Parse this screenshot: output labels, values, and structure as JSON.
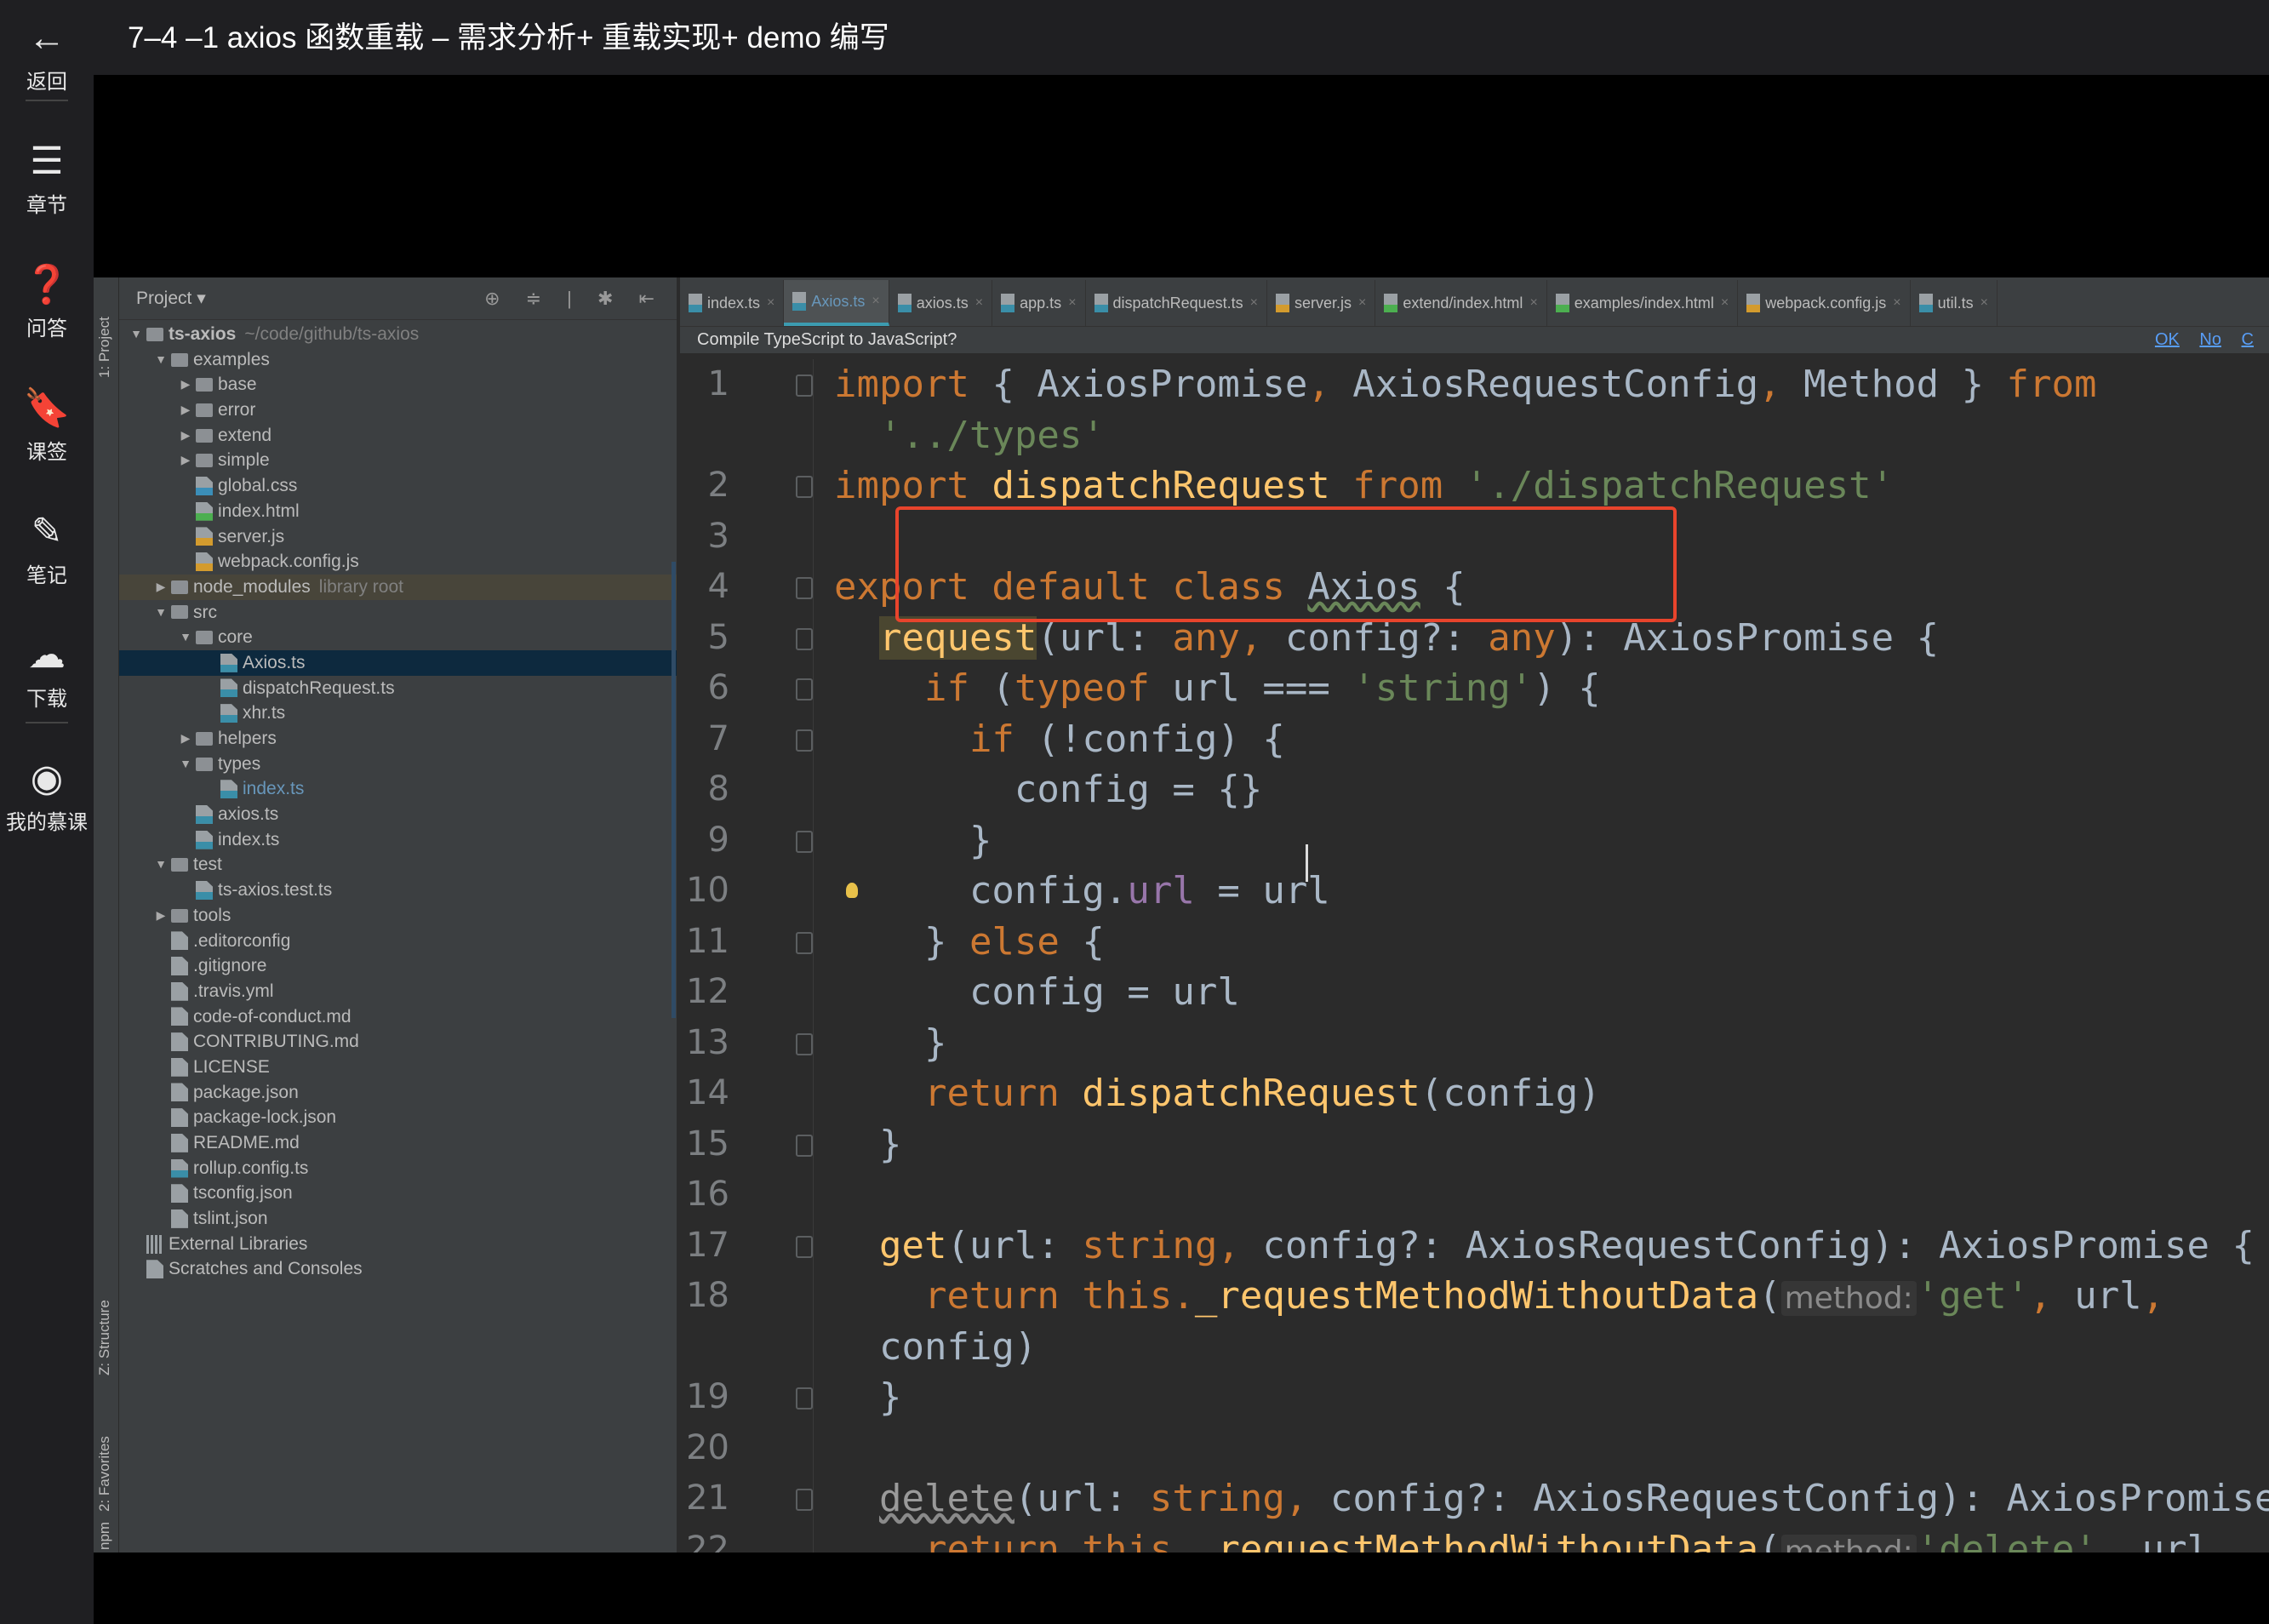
{
  "app": {
    "title": "7–4 –1 axios 函数重载 – 需求分析+ 重载实现+ demo 编写",
    "nav": [
      {
        "icon": "back-arrow-icon",
        "glyph": "←",
        "label": "返回"
      },
      {
        "icon": "menu-icon",
        "glyph": "☰",
        "label": "章节"
      },
      {
        "icon": "question-icon",
        "glyph": "❓",
        "label": "问答"
      },
      {
        "icon": "bookmark-icon",
        "glyph": "🔖",
        "label": "课签"
      },
      {
        "icon": "pencil-icon",
        "glyph": "✎",
        "label": "笔记"
      },
      {
        "icon": "cloud-download-icon",
        "glyph": "☁",
        "label": "下载"
      },
      {
        "icon": "avatar-icon",
        "glyph": "◉",
        "label": "我的慕课"
      }
    ]
  },
  "toolstrip": {
    "project": "1: Project",
    "structure": "Z: Structure",
    "favorites": "2: Favorites",
    "npm": "npm"
  },
  "project": {
    "header": "Project ▾",
    "tools": "⊕ ≑ | ✱ ⇤",
    "tree": [
      {
        "depth": 0,
        "kind": "folder",
        "arrow": "▼",
        "label": "ts-axios",
        "extra": "~/code/github/ts-axios",
        "style": "bold"
      },
      {
        "depth": 1,
        "kind": "folder",
        "arrow": "▼",
        "label": "examples"
      },
      {
        "depth": 2,
        "kind": "folder",
        "arrow": "▶",
        "label": "base"
      },
      {
        "depth": 2,
        "kind": "folder",
        "arrow": "▶",
        "label": "error"
      },
      {
        "depth": 2,
        "kind": "folder",
        "arrow": "▶",
        "label": "extend"
      },
      {
        "depth": 2,
        "kind": "folder",
        "arrow": "▶",
        "label": "simple"
      },
      {
        "depth": 2,
        "kind": "file",
        "tag": "#3b8eb8",
        "label": "global.css"
      },
      {
        "depth": 2,
        "kind": "file",
        "tag": "#4caf50",
        "label": "index.html"
      },
      {
        "depth": 2,
        "kind": "file",
        "tag": "#d39b2e",
        "label": "server.js"
      },
      {
        "depth": 2,
        "kind": "file",
        "tag": "#d39b2e",
        "label": "webpack.config.js"
      },
      {
        "depth": 1,
        "kind": "folder",
        "arrow": "▶",
        "label": "node_modules",
        "extra": "library root",
        "style": "lib"
      },
      {
        "depth": 1,
        "kind": "folder",
        "arrow": "▼",
        "label": "src"
      },
      {
        "depth": 2,
        "kind": "folder",
        "arrow": "▼",
        "label": "core"
      },
      {
        "depth": 3,
        "kind": "file",
        "tag": "#3a8ea8",
        "label": "Axios.ts",
        "style": "sel"
      },
      {
        "depth": 3,
        "kind": "file",
        "tag": "#3a8ea8",
        "label": "dispatchRequest.ts"
      },
      {
        "depth": 3,
        "kind": "file",
        "tag": "#3a8ea8",
        "label": "xhr.ts"
      },
      {
        "depth": 2,
        "kind": "folder",
        "arrow": "▶",
        "label": "helpers"
      },
      {
        "depth": 2,
        "kind": "folder",
        "arrow": "▼",
        "label": "types"
      },
      {
        "depth": 3,
        "kind": "file",
        "tag": "#3a8ea8",
        "label": "index.ts",
        "style": "blue"
      },
      {
        "depth": 2,
        "kind": "file",
        "tag": "#3a8ea8",
        "label": "axios.ts"
      },
      {
        "depth": 2,
        "kind": "file",
        "tag": "#3a8ea8",
        "label": "index.ts"
      },
      {
        "depth": 1,
        "kind": "folder",
        "arrow": "▼",
        "label": "test"
      },
      {
        "depth": 2,
        "kind": "file",
        "tag": "#3a8ea8",
        "label": "ts-axios.test.ts"
      },
      {
        "depth": 1,
        "kind": "folder",
        "arrow": "▶",
        "label": "tools"
      },
      {
        "depth": 1,
        "kind": "file",
        "label": ".editorconfig"
      },
      {
        "depth": 1,
        "kind": "file",
        "label": ".gitignore"
      },
      {
        "depth": 1,
        "kind": "file",
        "label": ".travis.yml"
      },
      {
        "depth": 1,
        "kind": "file",
        "label": "code-of-conduct.md"
      },
      {
        "depth": 1,
        "kind": "file",
        "label": "CONTRIBUTING.md"
      },
      {
        "depth": 1,
        "kind": "file",
        "label": "LICENSE"
      },
      {
        "depth": 1,
        "kind": "file",
        "label": "package.json"
      },
      {
        "depth": 1,
        "kind": "file",
        "label": "package-lock.json"
      },
      {
        "depth": 1,
        "kind": "file",
        "label": "README.md"
      },
      {
        "depth": 1,
        "kind": "file",
        "tag": "#3a8ea8",
        "label": "rollup.config.ts"
      },
      {
        "depth": 1,
        "kind": "file",
        "label": "tsconfig.json"
      },
      {
        "depth": 1,
        "kind": "file",
        "label": "tslint.json"
      },
      {
        "depth": 0,
        "kind": "lib",
        "label": "External Libraries"
      },
      {
        "depth": 0,
        "kind": "scratch",
        "label": "Scratches and Consoles"
      }
    ]
  },
  "tabs": [
    {
      "label": "index.ts",
      "tag": "#3a8ea8"
    },
    {
      "label": "Axios.ts",
      "tag": "#3a8ea8",
      "active": true
    },
    {
      "label": "axios.ts",
      "tag": "#3a8ea8"
    },
    {
      "label": "app.ts",
      "tag": "#3a8ea8"
    },
    {
      "label": "dispatchRequest.ts",
      "tag": "#3a8ea8"
    },
    {
      "label": "server.js",
      "tag": "#d39b2e"
    },
    {
      "label": "extend/index.html",
      "tag": "#4caf50"
    },
    {
      "label": "examples/index.html",
      "tag": "#4caf50"
    },
    {
      "label": "webpack.config.js",
      "tag": "#d39b2e"
    },
    {
      "label": "util.ts",
      "tag": "#3a8ea8"
    }
  ],
  "notice": {
    "text": "Compile TypeScript to JavaScript?",
    "ok": "OK",
    "no": "No",
    "cancel": "C"
  },
  "code": [
    {
      "num": "1",
      "fold": true,
      "t": [
        [
          "import",
          "kw"
        ],
        [
          " { AxiosPromise",
          "p"
        ],
        [
          ",",
          "kw"
        ],
        [
          " AxiosRequestConfig",
          "p"
        ],
        [
          ",",
          "kw"
        ],
        [
          " Method } ",
          "p"
        ],
        [
          "from",
          "kw"
        ]
      ]
    },
    {
      "num": "",
      "t": [
        [
          "  '../types'",
          "str"
        ]
      ]
    },
    {
      "num": "2",
      "fold": true,
      "t": [
        [
          "import ",
          "kw"
        ],
        [
          "dispatchRequest",
          "fn"
        ],
        [
          " from ",
          "kw"
        ],
        [
          "'./dispatchRequest'",
          "str"
        ]
      ]
    },
    {
      "num": "3",
      "t": []
    },
    {
      "num": "4",
      "fold": true,
      "t": [
        [
          "export default class ",
          "kw"
        ],
        [
          "Axios",
          "p wavy"
        ],
        [
          " {",
          "p"
        ]
      ]
    },
    {
      "num": "5",
      "fold": true,
      "t": [
        [
          "  ",
          "p"
        ],
        [
          "request",
          "fn hl"
        ],
        [
          "(url: ",
          "p"
        ],
        [
          "any",
          "kw"
        ],
        [
          ", ",
          "kw"
        ],
        [
          "config?: ",
          "p"
        ],
        [
          "any",
          "kw"
        ],
        [
          "): AxiosPromise {",
          "p"
        ]
      ]
    },
    {
      "num": "6",
      "fold": true,
      "t": [
        [
          "    if",
          "kw"
        ],
        [
          " (",
          "p"
        ],
        [
          "typeof",
          "kw"
        ],
        [
          " url === ",
          "p"
        ],
        [
          "'string'",
          "str"
        ],
        [
          ") {",
          "p"
        ]
      ]
    },
    {
      "num": "7",
      "fold": true,
      "t": [
        [
          "      if",
          "kw"
        ],
        [
          " (!config) {",
          "p"
        ]
      ]
    },
    {
      "num": "8",
      "t": [
        [
          "        config = {}",
          "p"
        ]
      ]
    },
    {
      "num": "9",
      "fold": true,
      "t": [
        [
          "      }",
          "p"
        ]
      ]
    },
    {
      "num": "10",
      "bulb": true,
      "t": [
        [
          "      config.",
          "p"
        ],
        [
          "url",
          "mem"
        ],
        [
          " = url",
          "p"
        ]
      ]
    },
    {
      "num": "11",
      "fold": true,
      "t": [
        [
          "    } ",
          "p"
        ],
        [
          "else",
          "kw"
        ],
        [
          " {",
          "p"
        ]
      ]
    },
    {
      "num": "12",
      "t": [
        [
          "      config = url",
          "p"
        ]
      ]
    },
    {
      "num": "13",
      "fold": true,
      "t": [
        [
          "    }",
          "p"
        ]
      ]
    },
    {
      "num": "14",
      "t": [
        [
          "    return ",
          "kw"
        ],
        [
          "dispatchRequest",
          "fn"
        ],
        [
          "(config)",
          "p"
        ]
      ]
    },
    {
      "num": "15",
      "fold": true,
      "t": [
        [
          "  }",
          "p"
        ]
      ]
    },
    {
      "num": "16",
      "t": []
    },
    {
      "num": "17",
      "fold": true,
      "t": [
        [
          "  ",
          "p"
        ],
        [
          "get",
          "fn"
        ],
        [
          "(url: ",
          "p"
        ],
        [
          "string",
          "kw"
        ],
        [
          ", ",
          "kw"
        ],
        [
          "config?: AxiosRequestConfig): AxiosPromise {",
          "p"
        ]
      ]
    },
    {
      "num": "18",
      "t": [
        [
          "    return this.",
          "kw"
        ],
        [
          "_requestMethodWithoutData",
          "fn"
        ],
        [
          "(",
          "p"
        ],
        [
          "method:",
          "hint"
        ],
        [
          "'get'",
          "str"
        ],
        [
          ", ",
          "kw"
        ],
        [
          "url",
          "p"
        ],
        [
          ",",
          "kw"
        ]
      ]
    },
    {
      "num": "",
      "t": [
        [
          "  config)",
          "p"
        ]
      ]
    },
    {
      "num": "19",
      "fold": true,
      "t": [
        [
          "  }",
          "p"
        ]
      ]
    },
    {
      "num": "20",
      "t": []
    },
    {
      "num": "21",
      "fold": true,
      "t": [
        [
          "  ",
          "p"
        ],
        [
          "delete",
          "unused"
        ],
        [
          "(url: ",
          "p"
        ],
        [
          "string",
          "kw"
        ],
        [
          ", ",
          "kw"
        ],
        [
          "config?: AxiosRequestConfig): AxiosPromise",
          "p"
        ]
      ]
    },
    {
      "num": "22",
      "t": [
        [
          "    return this.",
          "kw"
        ],
        [
          "_requestMethodWithoutData",
          "fn"
        ],
        [
          "(",
          "p"
        ],
        [
          "method:",
          "hint"
        ],
        [
          "'delete'",
          "str"
        ],
        [
          ", ",
          "kw"
        ],
        [
          "url",
          "p"
        ]
      ]
    }
  ]
}
